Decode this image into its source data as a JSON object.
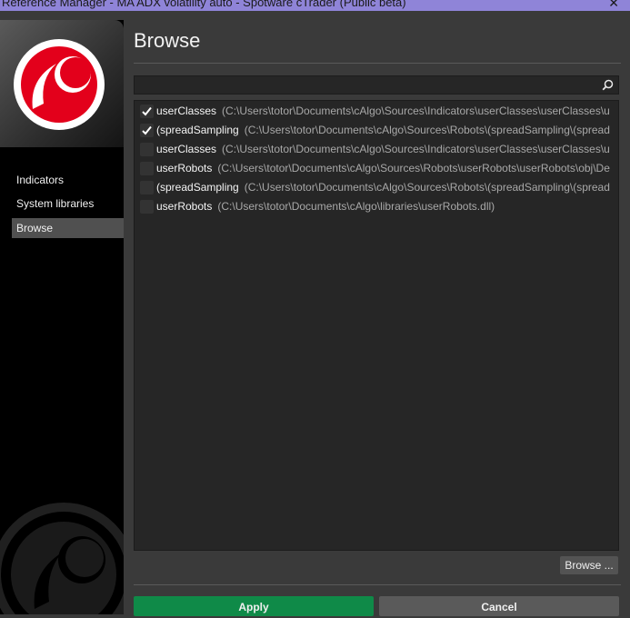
{
  "window": {
    "title": "Reference Manager - MA ADX volatility auto - Spotware cTrader (Public beta)",
    "close_glyph": "✕"
  },
  "sidebar": {
    "items": [
      {
        "label": "Indicators",
        "active": false
      },
      {
        "label": "System libraries",
        "active": false
      },
      {
        "label": "Browse",
        "active": true
      }
    ]
  },
  "main": {
    "title": "Browse",
    "search": {
      "value": "",
      "placeholder": ""
    },
    "references": [
      {
        "name": "userClasses",
        "path": "(C:\\Users\\totor\\Documents\\cAlgo\\Sources\\Indicators\\userClasses\\userClasses\\u",
        "checked": true
      },
      {
        "name": "(spreadSampling",
        "path": "(C:\\Users\\totor\\Documents\\cAlgo\\Sources\\Robots\\(spreadSampling\\(spread",
        "checked": true
      },
      {
        "name": "userClasses",
        "path": "(C:\\Users\\totor\\Documents\\cAlgo\\Sources\\Indicators\\userClasses\\userClasses\\u",
        "checked": false
      },
      {
        "name": "userRobots",
        "path": "(C:\\Users\\totor\\Documents\\cAlgo\\Sources\\Robots\\userRobots\\userRobots\\obj\\De",
        "checked": false
      },
      {
        "name": "(spreadSampling",
        "path": "(C:\\Users\\totor\\Documents\\cAlgo\\Sources\\Robots\\(spreadSampling\\(spread",
        "checked": false
      },
      {
        "name": "userRobots",
        "path": "(C:\\Users\\totor\\Documents\\cAlgo\\libraries\\userRobots.dll)",
        "checked": false
      }
    ],
    "browse_button": "Browse ...",
    "apply_button": "Apply",
    "cancel_button": "Cancel"
  },
  "colors": {
    "accent_red": "#e3001b",
    "apply_green": "#0f8a48",
    "title_bar": "#8f84d8"
  }
}
